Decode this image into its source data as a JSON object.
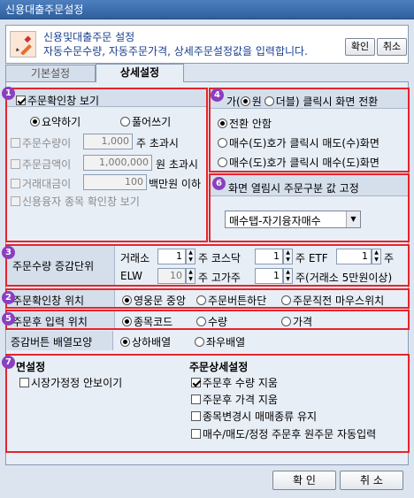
{
  "window": {
    "title": "신용대출주문설정"
  },
  "info": {
    "line1": "신용및대출주문 설정",
    "line2": "자동수문수량, 자동주문가격, 상세주문설정값을 입력합니다.",
    "ok": "확인",
    "cancel": "취소"
  },
  "tabs": [
    {
      "label": "기본설정"
    },
    {
      "label": "상세설정"
    }
  ],
  "badges": [
    "1",
    "2",
    "3",
    "4",
    "5",
    "6",
    "7"
  ],
  "sec1": {
    "title": "주문확인창 보기",
    "opt_a": "요약하기",
    "opt_b": "풀어쓰기",
    "rows": [
      {
        "label": "주문수량이",
        "value": "1,000",
        "unit": "주 초과시"
      },
      {
        "label": "주문금액이",
        "value": "1,000,000",
        "unit": "원 초과시"
      },
      {
        "label": "거래대금이",
        "value": "100",
        "unit": "백만원 이하"
      }
    ],
    "credit": "신용융자 종목 확인창 보기"
  },
  "sec4": {
    "title_pre": "가(",
    "opt_a": "원",
    "opt_b": "더블)",
    "title_post": "클릭시 화면 전환",
    "opts": [
      "전환 안함",
      "매수(도)호가 클릭시 매도(수)화면",
      "매수(도)호가 클릭시 매수(도)화면"
    ]
  },
  "sec6": {
    "title": "화면 열림시 주문구분 값 고정",
    "select": "매수탭-자기융자매수"
  },
  "sec3": {
    "label": "주문수량 증감단위",
    "exch": "거래소",
    "exch_v": "1",
    "kosdaq": "주 코스닥",
    "kosdaq_v": "1",
    "etf": "주 ETF",
    "etf_v": "1",
    "unit": "주",
    "elw": "ELW",
    "elw_v": "10",
    "kono": "주 고가주",
    "kono_v": "1",
    "kono_unit": "주(거래소 5만원이상)"
  },
  "sec2": {
    "label": "주문확인창 위치",
    "opts": [
      "영웅문 중앙",
      "주문버튼하단",
      "주문직전 마우스위치"
    ]
  },
  "sec5": {
    "label": "주문후 입력 위치",
    "opts": [
      "종목코드",
      "수량",
      "가격"
    ]
  },
  "incr": {
    "label": "증감버튼 배열모양",
    "opts": [
      "상하배열",
      "좌우배열"
    ]
  },
  "sec7": {
    "left_title": "면설정",
    "left_opt": "시장가정정 안보이기",
    "right_title": "주문상세설정",
    "right_opts": [
      "주문후 수량 지움",
      "주문후 가격 지움",
      "종목변경시 매매종류 유지",
      "매수/매도/정정 주문후 원주문 자동입력"
    ]
  },
  "footer": {
    "ok": "확 인",
    "cancel": "취 소"
  }
}
